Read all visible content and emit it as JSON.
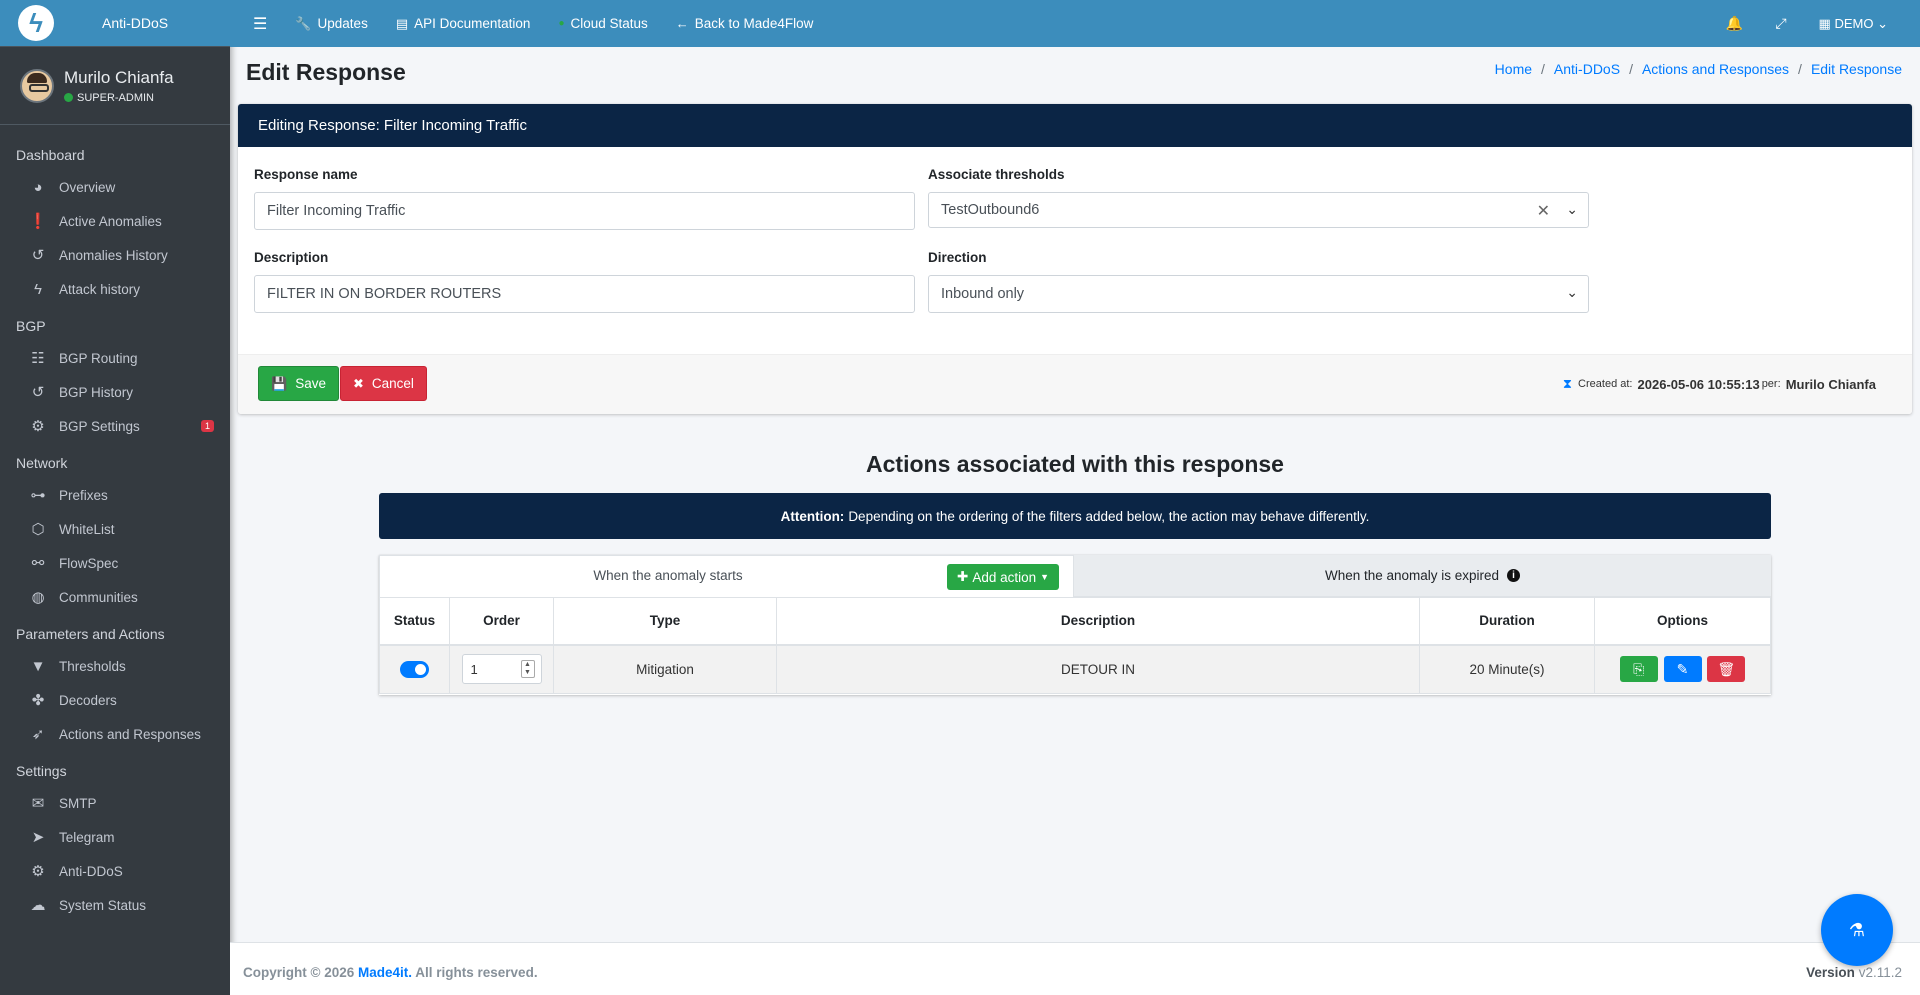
{
  "brand": {
    "name": "Anti-DDoS",
    "logo_icon": "bolt-logo-icon"
  },
  "user": {
    "name": "Murilo Chianfa",
    "role": "SUPER-ADMIN",
    "status_color": "#28a745"
  },
  "sidebar": {
    "sections": [
      {
        "header": "Dashboard",
        "items": [
          {
            "label": "Overview",
            "icon": "tachometer-icon"
          },
          {
            "label": "Active Anomalies",
            "icon": "exclamation-circle-icon"
          },
          {
            "label": "Anomalies History",
            "icon": "history-icon"
          },
          {
            "label": "Attack history",
            "icon": "bolt-icon"
          }
        ]
      },
      {
        "header": "BGP",
        "items": [
          {
            "label": "BGP Routing",
            "icon": "sitemap-icon"
          },
          {
            "label": "BGP History",
            "icon": "history-icon"
          },
          {
            "label": "BGP Settings",
            "icon": "gear-icon",
            "badge": "1"
          }
        ]
      },
      {
        "header": "Network",
        "items": [
          {
            "label": "Prefixes",
            "icon": "project-diagram-icon"
          },
          {
            "label": "WhiteList",
            "icon": "hexagon-icon"
          },
          {
            "label": "FlowSpec",
            "icon": "flow-icon"
          },
          {
            "label": "Communities",
            "icon": "globe-icon"
          }
        ]
      },
      {
        "header": "Parameters and Actions",
        "items": [
          {
            "label": "Thresholds",
            "icon": "filter-icon"
          },
          {
            "label": "Decoders",
            "icon": "puzzle-icon"
          },
          {
            "label": "Actions and Responses",
            "icon": "rocket-icon"
          }
        ]
      },
      {
        "header": "Settings",
        "items": [
          {
            "label": "SMTP",
            "icon": "mail-server-icon"
          },
          {
            "label": "Telegram",
            "icon": "telegram-icon"
          },
          {
            "label": "Anti-DDoS",
            "icon": "gears-icon"
          },
          {
            "label": "System Status",
            "icon": "cloud-upload-icon"
          }
        ]
      }
    ]
  },
  "topbar": {
    "updates": "Updates",
    "api_docs": "API Documentation",
    "cloud_status": "Cloud Status",
    "back": "Back to Made4Flow",
    "account": "DEMO"
  },
  "page": {
    "title": "Edit Response",
    "breadcrumb": [
      "Home",
      "Anti-DDoS",
      "Actions and Responses",
      "Edit Response"
    ]
  },
  "form": {
    "header": "Editing Response: Filter Incoming Traffic",
    "name_label": "Response name",
    "name_value": "Filter Incoming Traffic",
    "thresholds_label": "Associate thresholds",
    "thresholds_value": "TestOutbound6",
    "description_label": "Description",
    "description_value": "FILTER IN ON BORDER ROUTERS",
    "direction_label": "Direction",
    "direction_value": "Inbound only",
    "save_label": "Save",
    "cancel_label": "Cancel",
    "created_prefix": "Created at:",
    "created_at": "2026-05-06 10:55:13",
    "created_per": "per:",
    "created_by": "Murilo Chianfa"
  },
  "actions": {
    "title": "Actions associated with this response",
    "attention_label": "Attention:",
    "attention_text": "Depending on the ordering of the filters added below, the action may behave differently.",
    "tab_start": "When the anomaly starts",
    "tab_expired": "When the anomaly is expired",
    "add_action": "Add action",
    "columns": [
      "Status",
      "Order",
      "Type",
      "Description",
      "Duration",
      "Options"
    ],
    "rows": [
      {
        "order": "1",
        "type": "Mitigation",
        "description": "DETOUR IN",
        "duration": "20 Minute(s)",
        "enabled": true
      }
    ]
  },
  "footer": {
    "copyright": "Copyright © 2026",
    "company": "Made4it.",
    "rights": "All rights reserved.",
    "version_label": "Version",
    "version": "v2.11.2"
  },
  "colors": {
    "primary": "#3c8dbc",
    "dark_header": "#0b2545",
    "sidebar": "#343a40",
    "success": "#28a745",
    "danger": "#dc3545",
    "info": "#007bff"
  }
}
